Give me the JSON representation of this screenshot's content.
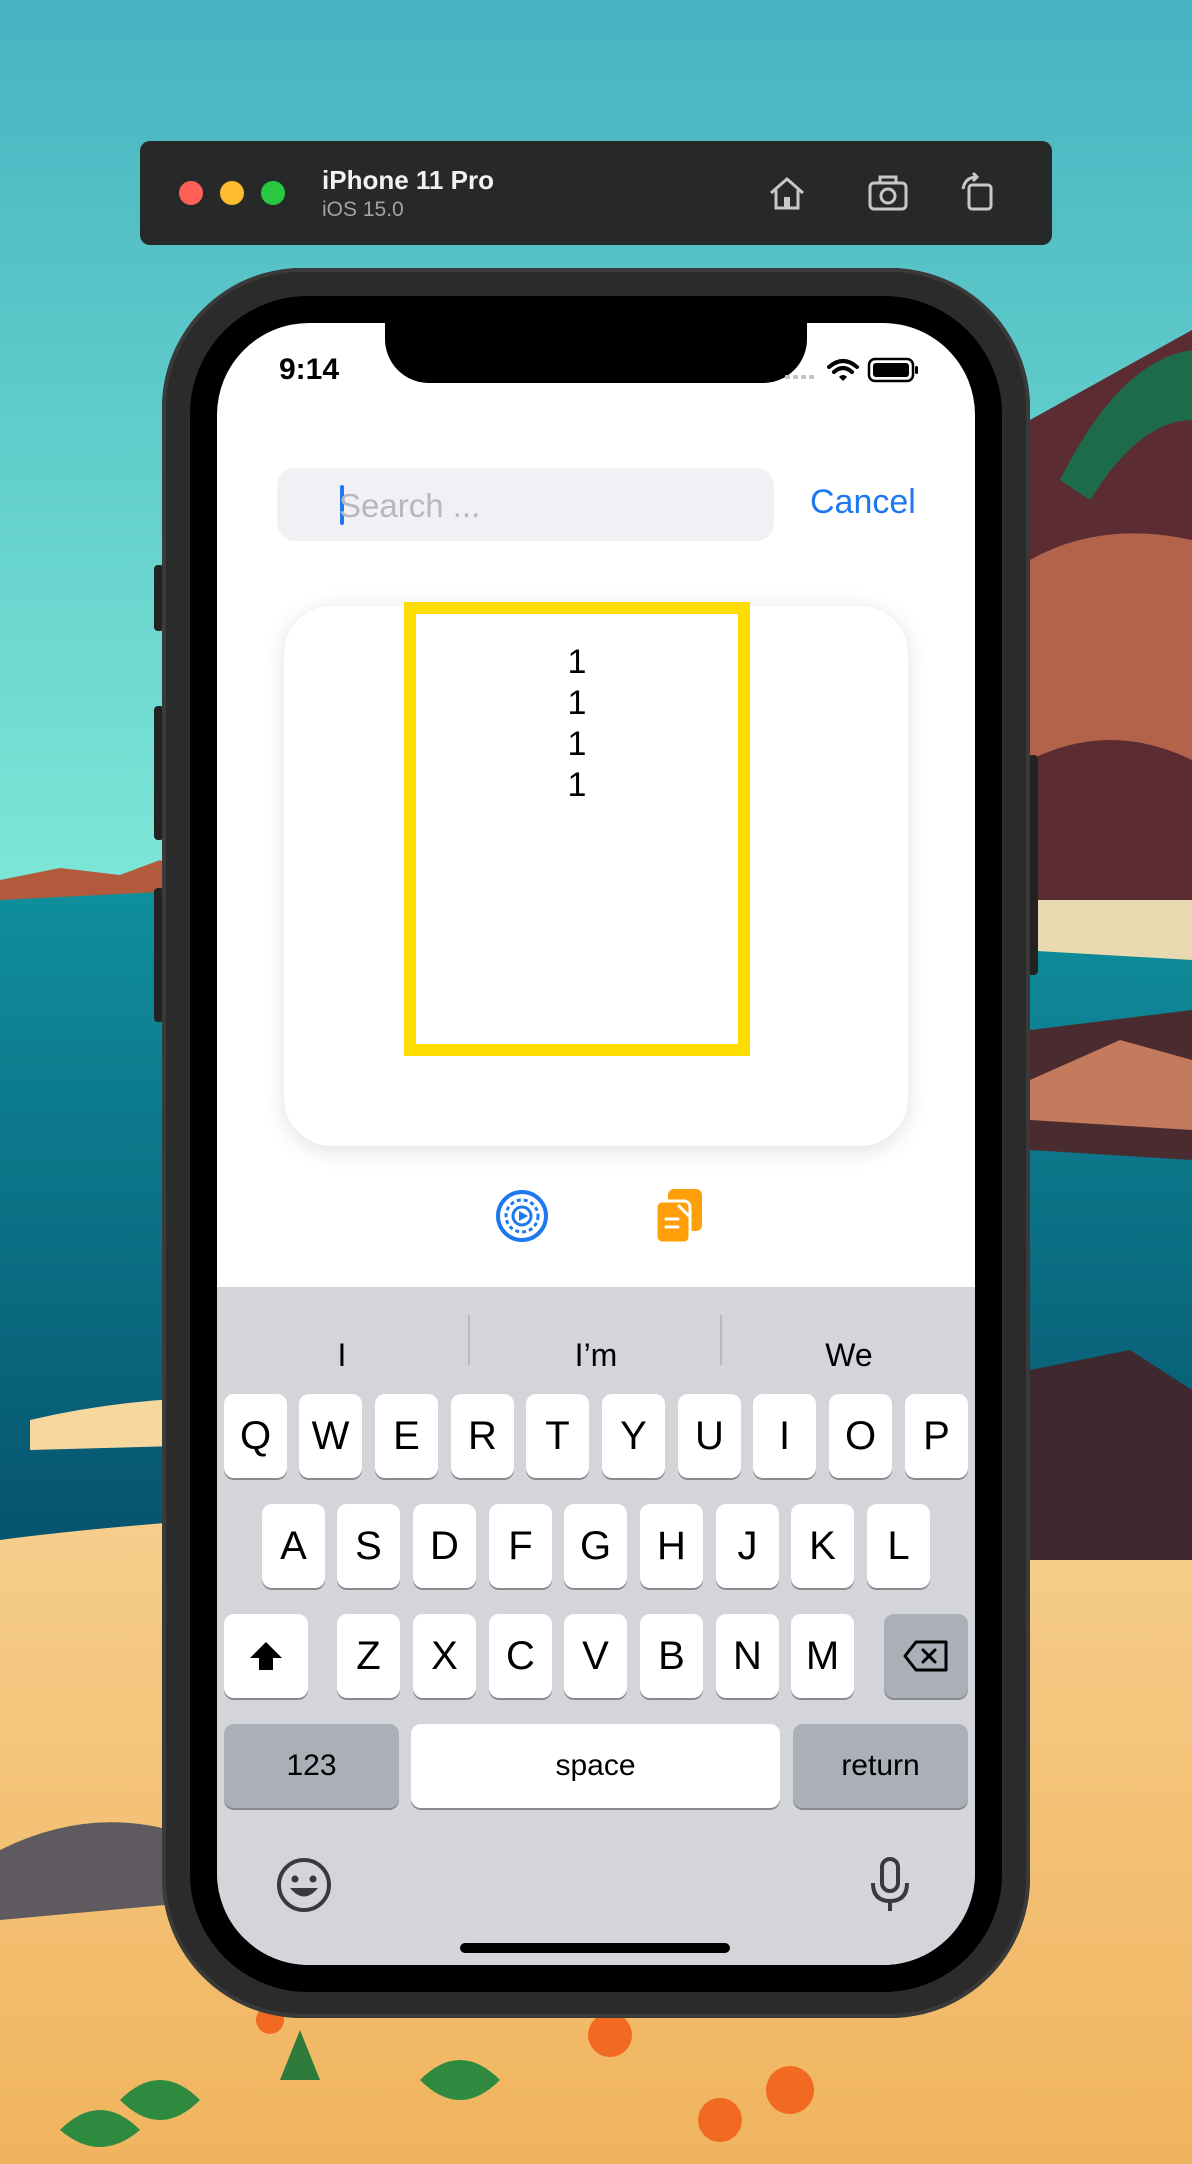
{
  "simulator": {
    "device_name": "iPhone 11 Pro",
    "os_version": "iOS 15.0",
    "buttons": [
      "home-icon",
      "screenshot-icon",
      "rotate-icon"
    ]
  },
  "status_bar": {
    "time": "9:14"
  },
  "search": {
    "placeholder": "Search ...",
    "value": "",
    "cancel_label": "Cancel"
  },
  "card": {
    "lines": [
      "1",
      "1",
      "1",
      "1"
    ]
  },
  "actions": [
    "settings-icon",
    "copy-icon"
  ],
  "keyboard": {
    "suggestions": [
      "I",
      "I’m",
      "We"
    ],
    "row1": [
      "Q",
      "W",
      "E",
      "R",
      "T",
      "Y",
      "U",
      "I",
      "O",
      "P"
    ],
    "row2": [
      "A",
      "S",
      "D",
      "F",
      "G",
      "H",
      "J",
      "K",
      "L"
    ],
    "row3": [
      "Z",
      "X",
      "C",
      "V",
      "B",
      "N",
      "M"
    ],
    "numbers_label": "123",
    "space_label": "space",
    "return_label": "return"
  },
  "colors": {
    "accent": "#1e78f0",
    "highlight_frame": "#fedd00",
    "copy_icon": "#ff9f0a"
  }
}
